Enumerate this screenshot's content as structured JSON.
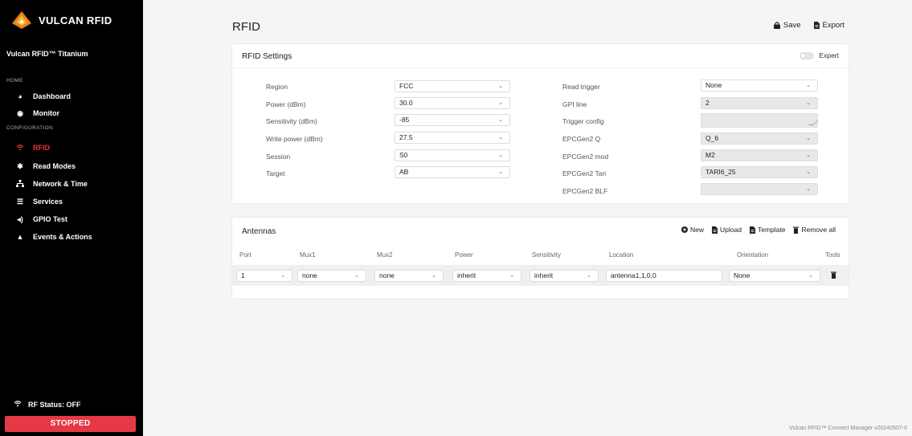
{
  "brand": {
    "name": "VULCAN RFID",
    "accent": "#e53945"
  },
  "device_name": "Vulcan RFID™ Titanium",
  "nav": {
    "home_label": "HOME",
    "config_label": "CONFIGURATION",
    "items": [
      {
        "label": "Dashboard",
        "icon": "gauge-icon"
      },
      {
        "label": "Monitor",
        "icon": "eye-icon"
      },
      {
        "label": "RFID",
        "icon": "wifi-icon",
        "active": true
      },
      {
        "label": "Read Modes",
        "icon": "gear-icon"
      },
      {
        "label": "Network & Time",
        "icon": "network-icon"
      },
      {
        "label": "Services",
        "icon": "server-icon"
      },
      {
        "label": "GPIO Test",
        "icon": "speaker-icon"
      },
      {
        "label": "Events & Actions",
        "icon": "bell-icon"
      }
    ]
  },
  "rf_status": "RF Status: OFF",
  "stop_button": "STOPPED",
  "page_title": "RFID",
  "top_actions": {
    "save": "Save",
    "export": "Export"
  },
  "settings": {
    "title": "RFID Settings",
    "expert_label": "Expert",
    "left": [
      {
        "label": "Region",
        "value": "FCC"
      },
      {
        "label": "Power (dBm)",
        "value": "30.0"
      },
      {
        "label": "Sensitivity (dBm)",
        "value": "-85"
      },
      {
        "label": "Write power (dBm)",
        "value": "27.5"
      },
      {
        "label": "Session",
        "value": "S0"
      },
      {
        "label": "Target",
        "value": "AB"
      }
    ],
    "right": [
      {
        "label": "Read trigger",
        "value": "None"
      },
      {
        "label": "GPI line",
        "value": "2"
      },
      {
        "label": "Trigger config",
        "value": ""
      },
      {
        "label": "EPCGen2 Q",
        "value": "Q_6"
      },
      {
        "label": "EPCGen2 mod",
        "value": "M2"
      },
      {
        "label": "EPCGen2 Tari",
        "value": "TARI6_25"
      },
      {
        "label": "EPCGen2 BLF",
        "value": ""
      }
    ]
  },
  "antennas": {
    "title": "Antennas",
    "actions": {
      "new": "New",
      "upload": "Upload",
      "template": "Template",
      "remove_all": "Remove all"
    },
    "columns": [
      "Port",
      "Mux1",
      "Mux2",
      "Power",
      "Sensitivity",
      "Location",
      "Orientation",
      "Tools"
    ],
    "row": {
      "port": "1",
      "mux1": "none",
      "mux2": "none",
      "power": "inherit",
      "sensitivity": "inherit",
      "location": "antenna1,1,0,0",
      "orientation": "None"
    }
  },
  "footer": "Vulcan RFID™ Connect Manager v20240507-0"
}
